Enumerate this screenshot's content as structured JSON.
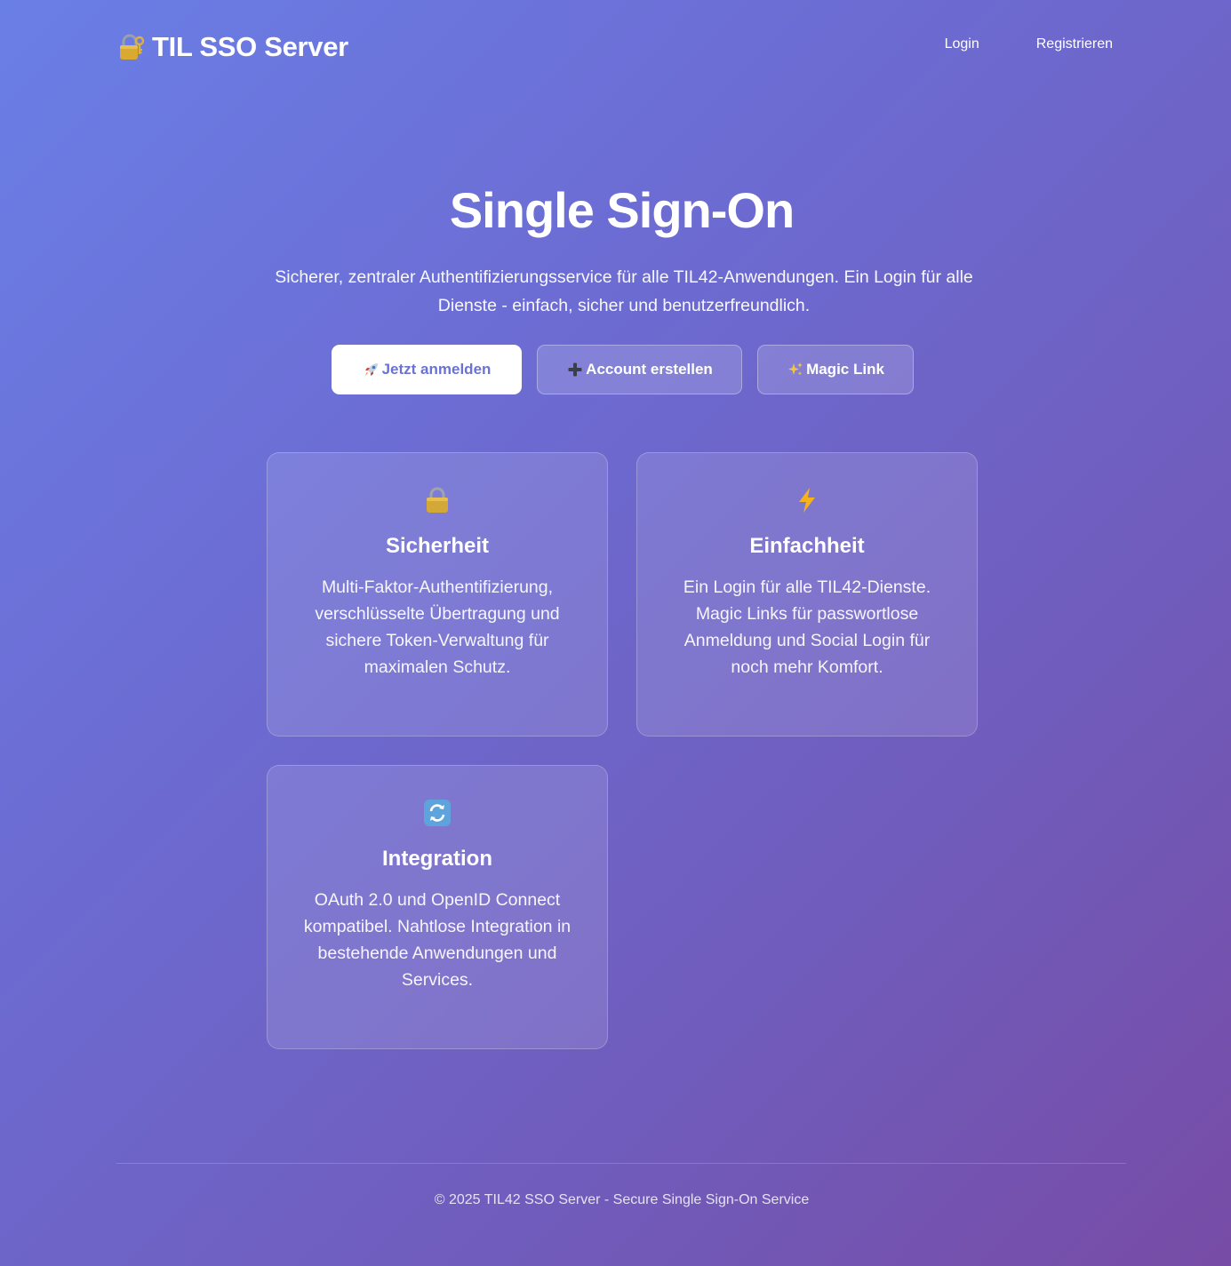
{
  "header": {
    "brand_title": "TIL SSO Server",
    "brand_icon": "lock-with-key-icon",
    "nav": [
      {
        "label": "Login"
      },
      {
        "label": "Registrieren"
      }
    ]
  },
  "hero": {
    "title": "Single Sign-On",
    "subtitle": "Sicherer, zentraler Authentifizierungsservice für alle TIL42-Anwendungen. Ein Login für alle Dienste - einfach, sicher und benutzerfreundlich."
  },
  "actions": {
    "login": {
      "icon": "rocket-icon",
      "label": "Jetzt anmelden"
    },
    "register": {
      "icon": "plus-icon",
      "label": "Account erstellen"
    },
    "magic": {
      "icon": "sparkles-icon",
      "label": "Magic Link"
    }
  },
  "features": [
    {
      "icon": "padlock-icon",
      "title": "Sicherheit",
      "text": "Multi-Faktor-Authentifizierung, verschlüsselte Übertragung und sichere Token-Verwaltung für maximalen Schutz."
    },
    {
      "icon": "lightning-icon",
      "title": "Einfachheit",
      "text": "Ein Login für alle TIL42-Dienste. Magic Links für passwortlose Anmeldung und Social Login für noch mehr Komfort."
    },
    {
      "icon": "refresh-arrows-icon",
      "title": "Integration",
      "text": "OAuth 2.0 und OpenID Connect kompatibel. Nahtlose Integration in bestehende Anwendungen und Services."
    }
  ],
  "footer": {
    "text": "© 2025 TIL42 SSO Server - Secure Single Sign-On Service"
  },
  "colors": {
    "gradient_start": "#6a7fe6",
    "gradient_end": "#774ca6",
    "primary_button_text": "#6a72d6"
  }
}
